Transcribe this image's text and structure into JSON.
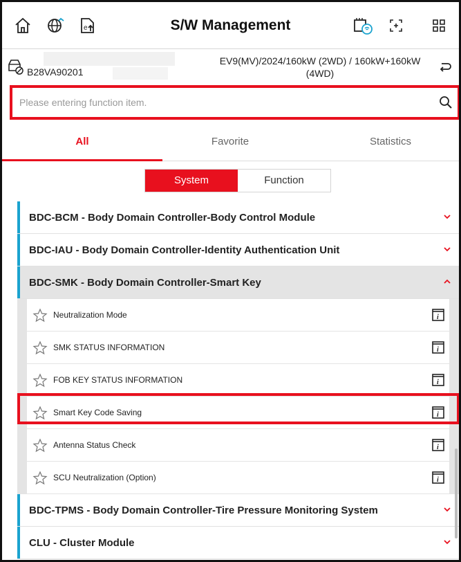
{
  "header": {
    "title": "S/W Management",
    "icons": [
      "home-icon",
      "globe-network-icon",
      "vehicle-export-icon",
      "vci-wireless-icon",
      "screen-capture-icon",
      "grid-menu-icon"
    ]
  },
  "vehicle": {
    "vin": "B28VA90201",
    "model": "EV9(MV)/2024/160kW (2WD) / 160kW+160kW (4WD)"
  },
  "search": {
    "placeholder": "Please entering function item."
  },
  "tabs": [
    {
      "label": "All",
      "active": true
    },
    {
      "label": "Favorite",
      "active": false
    },
    {
      "label": "Statistics",
      "active": false
    }
  ],
  "segment": [
    {
      "label": "System",
      "active": true
    },
    {
      "label": "Function",
      "active": false
    }
  ],
  "groups": [
    {
      "label": "BDC-BCM - Body Domain Controller-Body Control Module",
      "expanded": false
    },
    {
      "label": "BDC-IAU - Body Domain Controller-Identity Authentication Unit",
      "expanded": false
    },
    {
      "label": "BDC-SMK - Body Domain Controller-Smart Key",
      "expanded": true
    }
  ],
  "smk_items": [
    "Neutralization Mode",
    "SMK STATUS INFORMATION",
    "FOB KEY STATUS INFORMATION",
    "Smart Key Code Saving",
    "Antenna Status Check",
    "SCU Neutralization (Option)"
  ],
  "groups_after": [
    {
      "label": "BDC-TPMS - Body Domain Controller-Tire Pressure Monitoring System",
      "expanded": false
    },
    {
      "label": "CLU - Cluster Module",
      "expanded": false
    }
  ],
  "colors": {
    "accent": "#e8101e",
    "group_marker": "#1aa3cf"
  }
}
